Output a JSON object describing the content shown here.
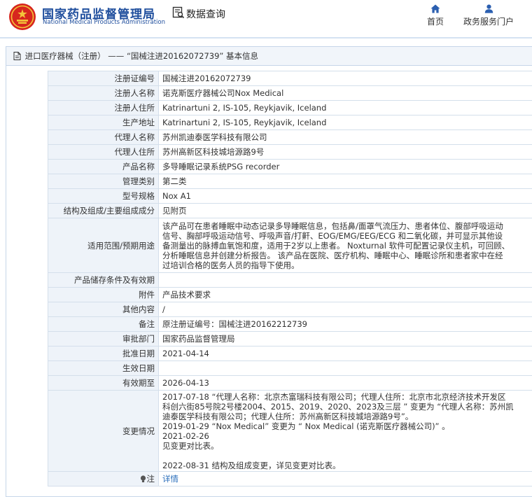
{
  "header": {
    "site_name_cn": "国家药品监督管理局",
    "site_name_en": "National Medical Products Administration",
    "query_label": "数据查询",
    "nav": {
      "home": "首页",
      "service": "政务服务门户"
    },
    "colors": {
      "brand": "#1f4e9d",
      "emblem_red": "#d7261e",
      "emblem_gold": "#f3c53a",
      "nav_icon": "#2b5fb0"
    }
  },
  "panel": {
    "breadcrumb": "进口医疗器械（注册） —— “国械注进20162072739” 基本信息"
  },
  "record": {
    "reg_no": {
      "label": "注册证编号",
      "value": "国械注进20162072739"
    },
    "registrant": {
      "label": "注册人名称",
      "value": "诺克斯医疗器械公司Nox Medical"
    },
    "registrant_addr": {
      "label": "注册人住所",
      "value": "Katrinartuni 2, IS-105, Reykjavik, Iceland"
    },
    "production_addr": {
      "label": "生产地址",
      "value": "Katrinartuni 2, IS-105, Reykjavik, Iceland"
    },
    "agent": {
      "label": "代理人名称",
      "value": "苏州凯迪泰医学科技有限公司"
    },
    "agent_addr": {
      "label": "代理人住所",
      "value": "苏州高新区科技城培源路9号"
    },
    "product_name": {
      "label": "产品名称",
      "value": "多导睡眠记录系统PSG recorder"
    },
    "category": {
      "label": "管理类别",
      "value": "第二类"
    },
    "model": {
      "label": "型号规格",
      "value": "Nox A1"
    },
    "structure": {
      "label": "结构及组成/主要组成成分",
      "value": "见附页"
    },
    "scope": {
      "label": "适用范围/预期用途",
      "value": "该产品可在患者睡眠中动态记录多导睡眠信息，包括鼻/面罩气流压力、患者体位、腹部呼吸运动\n信号、胸部呼吸运动信号、呼吸声音/打鼾、EOG/EMG/EEG/ECG 和二氧化碳，并可显示其他设\n备测量出的脉搏血氧饱和度，适用于2岁以上患者。 Noxturnal 软件可配置记录仪主机，可回顾、\n分析睡眠信息并创建分析报告。 该产品在医院、医疗机构、睡眠中心、睡眠诊所和患者家中在经\n过培训合格的医务人员的指导下使用。"
    },
    "storage": {
      "label": "产品储存条件及有效期",
      "value": ""
    },
    "attachment": {
      "label": "附件",
      "value": "产品技术要求"
    },
    "other": {
      "label": "其他内容",
      "value": "/"
    },
    "remark": {
      "label": "备注",
      "value": "原注册证编号：国械注进20162212739"
    },
    "approval_dept": {
      "label": "审批部门",
      "value": "国家药品监督管理局"
    },
    "approval_date": {
      "label": "批准日期",
      "value": "2021-04-14"
    },
    "effective_date": {
      "label": "生效日期",
      "value": ""
    },
    "expiry_date": {
      "label": "有效期至",
      "value": "2026-04-13"
    },
    "changes": {
      "label": "变更情况",
      "value": "2017-07-18 “代理人名称：北京杰富瑞科技有限公司；代理人住所：北京市北京经济技术开发区\n科创六街85号院2号楼2004、2015、2019、2020、2023及三层 ” 变更为 “代理人名称：苏州凯\n迪泰医学科技有限公司；代理人住所：苏州高新区科技城培源路9号”。\n2019-01-29 “Nox Medical” 变更为 “ Nox Medical (诺克斯医疗器械公司)” 。\n2021-02-26\n见变更对比表。\n\n2022-08-31 结构及组成变更，详见变更对比表。"
    },
    "note": {
      "label": "注",
      "value": "详情"
    }
  }
}
